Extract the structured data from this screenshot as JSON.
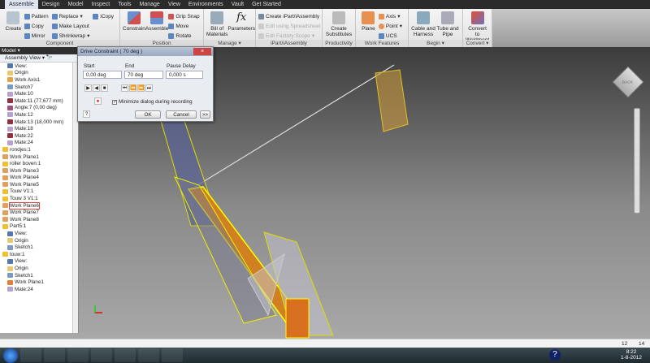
{
  "tabs": [
    "Assemble",
    "Design",
    "Model",
    "Inspect",
    "Tools",
    "Manage",
    "View",
    "Environments",
    "Vault",
    "Get Started"
  ],
  "ribbon": {
    "component": {
      "title": "Component",
      "create": "Create",
      "pattern": "Pattern",
      "copy": "Copy",
      "mirror": "Mirror",
      "replace": "Replace",
      "make_layout": "Make Layout",
      "shrinkwrap": "Shrinkwrap",
      "icopy": "iCopy"
    },
    "position": {
      "title": "Position",
      "constrain": "Constrain",
      "assemble": "Assemble",
      "grip_snap": "Grip Snap",
      "move": "Move",
      "rotate": "Rotate"
    },
    "manage": {
      "title": "Manage",
      "bom": "Bill of Materials",
      "parameters": "Parameters"
    },
    "ipart": {
      "title": "iPart/iAssembly",
      "create": "Create iPart/iAssembly",
      "edit_spreadsheet": "Edit using Spreadsheet",
      "edit_factory": "Edit Factory Scope"
    },
    "productivity": {
      "title": "Productivity",
      "create_substitutes": "Create Substitutes"
    },
    "work_features": {
      "title": "Work Features",
      "plane": "Plane",
      "axis": "Axis",
      "point": "Point",
      "ucs": "UCS"
    },
    "begin": {
      "title": "Begin",
      "cable": "Cable and Harness",
      "tube": "Tube and Pipe"
    },
    "convert": {
      "title": "Convert",
      "weldment": "Convert to Weldment"
    }
  },
  "browser": {
    "header": "Model",
    "view": "Assembly View",
    "items": [
      {
        "label": "View:",
        "indent": 1,
        "color": "#57a"
      },
      {
        "label": "Origin",
        "indent": 1,
        "color": "#e8c870"
      },
      {
        "label": "Work Axis1",
        "indent": 1,
        "color": "#e8a040"
      },
      {
        "label": "Sketch7",
        "indent": 1,
        "color": "#7a9ac0"
      },
      {
        "label": "Mate:10",
        "indent": 1,
        "color": "#b9a0d0"
      },
      {
        "label": "Mate:11 (77,677 mm)",
        "indent": 1,
        "color": "#903040"
      },
      {
        "label": "Angle:7 (0,00 deg)",
        "indent": 1,
        "color": "#a05080"
      },
      {
        "label": "Mate:12",
        "indent": 1,
        "color": "#b9a0d0"
      },
      {
        "label": "Mate:13 (18,000 mm)",
        "indent": 1,
        "color": "#903040"
      },
      {
        "label": "Mate:18",
        "indent": 1,
        "color": "#b9a0d0"
      },
      {
        "label": "Mate:22",
        "indent": 1,
        "color": "#903040"
      },
      {
        "label": "Mate:24",
        "indent": 1,
        "color": "#b9a0d0"
      },
      {
        "label": "rondjes:1",
        "indent": 0,
        "color": "#f0c030"
      },
      {
        "label": "Work Plane1",
        "indent": 0,
        "color": "#e0a060"
      },
      {
        "label": "roller boven:1",
        "indent": 0,
        "color": "#f0c030"
      },
      {
        "label": "Work Plane3",
        "indent": 0,
        "color": "#e0a060"
      },
      {
        "label": "Work Plane4",
        "indent": 0,
        "color": "#e0a060"
      },
      {
        "label": "Work Plane5",
        "indent": 0,
        "color": "#e0a060"
      },
      {
        "label": "Touw V1:1",
        "indent": 0,
        "color": "#f0c030"
      },
      {
        "label": "Touw 3 V1:1",
        "indent": 0,
        "color": "#f0c030"
      },
      {
        "label": "Work Plane6",
        "indent": 0,
        "color": "#e0a060",
        "selected": true
      },
      {
        "label": "Work Plane7",
        "indent": 0,
        "color": "#e0a060"
      },
      {
        "label": "Work Plane8",
        "indent": 0,
        "color": "#e0a060"
      },
      {
        "label": "Part5:1",
        "indent": 0,
        "color": "#f0c030"
      },
      {
        "label": "View:",
        "indent": 1,
        "color": "#57a"
      },
      {
        "label": "Origin",
        "indent": 1,
        "color": "#e8c870"
      },
      {
        "label": "Sketch1",
        "indent": 1,
        "color": "#7a9ac0"
      },
      {
        "label": "touw:1",
        "indent": 0,
        "color": "#f0c030"
      },
      {
        "label": "View:",
        "indent": 1,
        "color": "#57a"
      },
      {
        "label": "Origin",
        "indent": 1,
        "color": "#e8c870"
      },
      {
        "label": "Sketch1",
        "indent": 1,
        "color": "#7a9ac0"
      },
      {
        "label": "Work Plane1",
        "indent": 1,
        "color": "#e08030"
      },
      {
        "label": "Mate:24",
        "indent": 1,
        "color": "#b9a0d0"
      }
    ]
  },
  "dialog": {
    "title": "Drive Constraint  ( 70 deg )",
    "start_label": "Start",
    "start_value": "0,00 deg",
    "end_label": "End",
    "end_value": "70 deg",
    "pause_label": "Pause Delay",
    "pause_value": "0,000 s",
    "minimize_label": "Minimize dialog during recording",
    "minimize_checked": true,
    "ok": "OK",
    "cancel": "Cancel",
    "more": ">>"
  },
  "viewcube": {
    "face": "BACK"
  },
  "status": {
    "left": "12",
    "right": "14"
  },
  "taskbar": {
    "time": "8:22",
    "date": "1-8-2012"
  }
}
